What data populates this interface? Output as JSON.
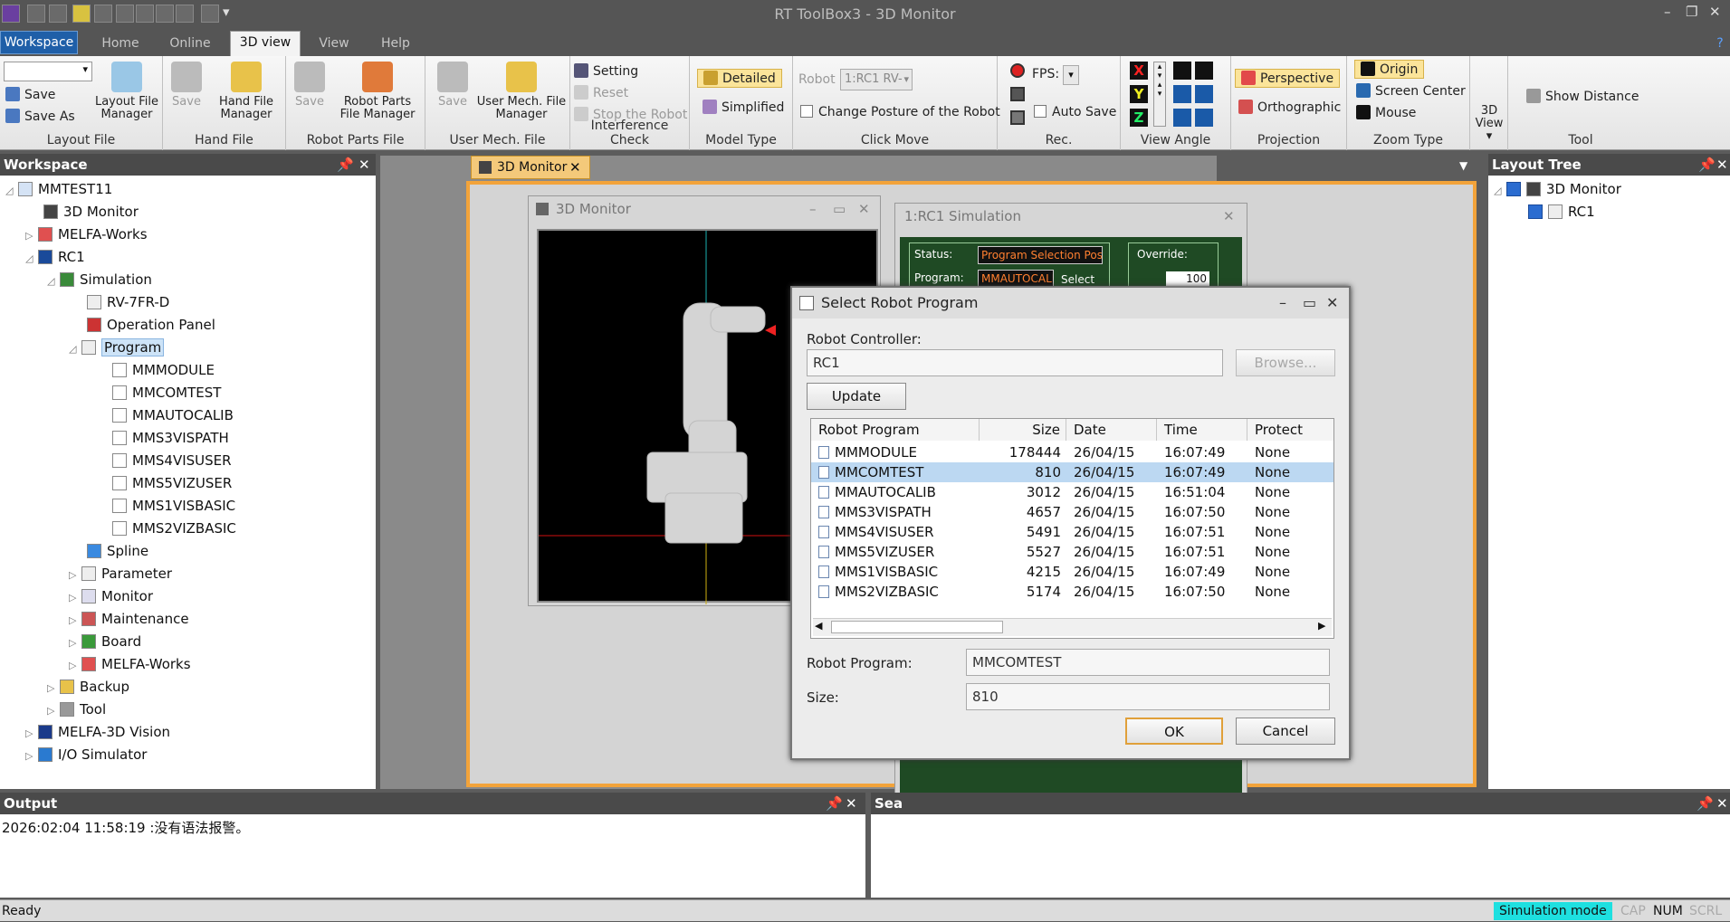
{
  "app": {
    "title": "RT ToolBox3 - 3D Monitor"
  },
  "tabs": {
    "workspace": "Workspace",
    "home": "Home",
    "online": "Online",
    "view3d": "3D view",
    "view": "View",
    "help": "Help"
  },
  "ribbon": {
    "layout_file": {
      "save": "Save",
      "save_as": "Save As",
      "manager": "Layout File Manager",
      "group": "Layout File"
    },
    "hand_file": {
      "save": "Save",
      "manager": "Hand File Manager",
      "group": "Hand File"
    },
    "robot_parts": {
      "save": "Save",
      "manager": "Robot Parts File Manager",
      "group": "Robot Parts File"
    },
    "user_mech": {
      "save": "Save",
      "manager": "User Mech. File Manager",
      "group": "User Mech. File"
    },
    "interference": {
      "setting": "Setting",
      "reset": "Reset",
      "stop": "Stop the Robot",
      "group": "Interference Check"
    },
    "model_type": {
      "detailed": "Detailed",
      "simplified": "Simplified",
      "group": "Model Type"
    },
    "click_move": {
      "robot_label": "Robot",
      "robot_value": "1:RC1 RV-",
      "change_posture": "Change Posture of the Robot",
      "group": "Click Move"
    },
    "rec": {
      "fps": "FPS:",
      "auto_save": "Auto Save",
      "group": "Rec."
    },
    "view_angle": {
      "x": "X",
      "y": "Y",
      "z": "Z",
      "group": "View Angle"
    },
    "projection": {
      "perspective": "Perspective",
      "orthographic": "Orthographic",
      "group": "Projection"
    },
    "zoom": {
      "origin": "Origin",
      "screen_center": "Screen Center",
      "mouse": "Mouse",
      "group": "Zoom Type"
    },
    "view3d": {
      "label": "3D View"
    },
    "tool": {
      "show_distance": "Show Distance",
      "group": "Tool"
    }
  },
  "workspace": {
    "title": "Workspace",
    "tree": [
      {
        "label": "MMTEST11"
      },
      {
        "label": "3D Monitor"
      },
      {
        "label": "MELFA-Works"
      },
      {
        "label": "RC1"
      },
      {
        "label": "Simulation"
      },
      {
        "label": "RV-7FR-D"
      },
      {
        "label": "Operation Panel"
      },
      {
        "label": "Program"
      },
      {
        "label": "MMMODULE"
      },
      {
        "label": "MMCOMTEST"
      },
      {
        "label": "MMAUTOCALIB"
      },
      {
        "label": "MMS3VISPATH"
      },
      {
        "label": "MMS4VISUSER"
      },
      {
        "label": "MMS5VIZUSER"
      },
      {
        "label": "MMS1VISBASIC"
      },
      {
        "label": "MMS2VIZBASIC"
      },
      {
        "label": "Spline"
      },
      {
        "label": "Parameter"
      },
      {
        "label": "Monitor"
      },
      {
        "label": "Maintenance"
      },
      {
        "label": "Board"
      },
      {
        "label": "MELFA-Works"
      },
      {
        "label": "Backup"
      },
      {
        "label": "Tool"
      },
      {
        "label": "MELFA-3D Vision"
      },
      {
        "label": "I/O Simulator"
      }
    ]
  },
  "document": {
    "tab": "3D Monitor",
    "monitor_title": "3D Monitor"
  },
  "simulation": {
    "title": "1:RC1  Simulation",
    "status_label": "Status:",
    "status_value": "Program Selection Possible",
    "program_label": "Program:",
    "program_value": "MMAUTOCALIB",
    "select": "Select",
    "override_label": "Override:",
    "override_value": "100"
  },
  "dialog": {
    "title": "Select Robot Program",
    "controller_label": "Robot Controller:",
    "controller_value": "RC1",
    "browse": "Browse...",
    "update": "Update",
    "columns": [
      "Robot Program",
      "Size",
      "Date",
      "Time",
      "Protect"
    ],
    "rows": [
      [
        "MMMODULE",
        "178444",
        "26/04/15",
        "16:07:49",
        "None"
      ],
      [
        "MMCOMTEST",
        "810",
        "26/04/15",
        "16:07:49",
        "None"
      ],
      [
        "MMAUTOCALIB",
        "3012",
        "26/04/15",
        "16:51:04",
        "None"
      ],
      [
        "MMS3VISPATH",
        "4657",
        "26/04/15",
        "16:07:50",
        "None"
      ],
      [
        "MMS4VISUSER",
        "5491",
        "26/04/15",
        "16:07:51",
        "None"
      ],
      [
        "MMS5VIZUSER",
        "5527",
        "26/04/15",
        "16:07:51",
        "None"
      ],
      [
        "MMS1VISBASIC",
        "4215",
        "26/04/15",
        "16:07:49",
        "None"
      ],
      [
        "MMS2VIZBASIC",
        "5174",
        "26/04/15",
        "16:07:50",
        "None"
      ]
    ],
    "program_label": "Robot Program:",
    "program_value": "MMCOMTEST",
    "size_label": "Size:",
    "size_value": "810",
    "ok": "OK",
    "cancel": "Cancel"
  },
  "layout_tree": {
    "title": "Layout Tree",
    "items": [
      {
        "label": "3D Monitor"
      },
      {
        "label": "RC1"
      }
    ]
  },
  "output": {
    "title": "Output",
    "line": "2026:02:04 11:58:19 :没有语法报警。"
  },
  "search": {
    "title": "Sea"
  },
  "statusbar": {
    "ready": "Ready",
    "mode": "Simulation mode",
    "cap": "CAP",
    "num": "NUM",
    "scrl": "SCRL"
  },
  "colors": {
    "accent": "#1f5fa8",
    "tab_active": "#f4c97a",
    "sim_bg": "#1f4a24",
    "status_mode": "#1ee0e0"
  }
}
